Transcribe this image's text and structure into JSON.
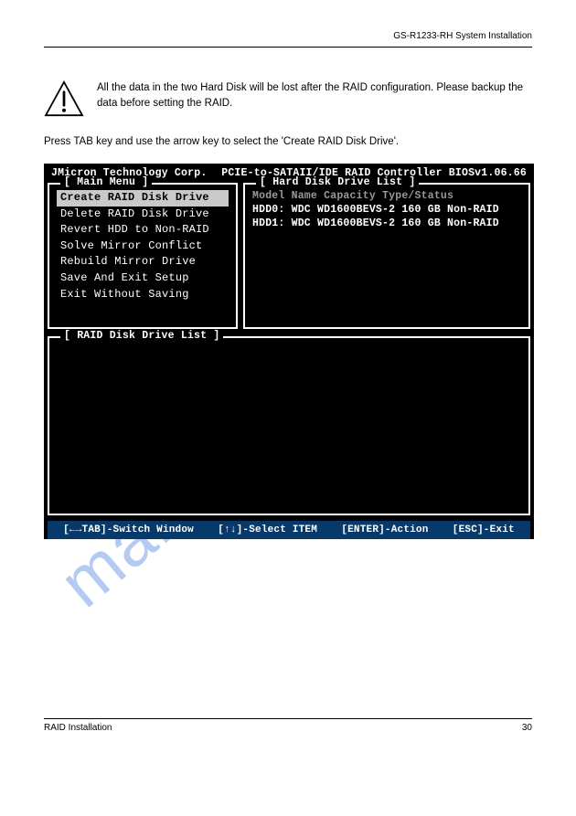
{
  "header": {
    "right": "GS-R1233-RH System Installation"
  },
  "warning": {
    "text": "All the data in the two Hard Disk will be lost after the RAID configuration. Please backup the data before setting the RAID."
  },
  "intro": "Press TAB key and use the arrow key to select the 'Create RAID Disk Drive'.",
  "bios": {
    "title_left": "JMicron Technology Corp.",
    "title_right": "PCIE-to-SATAII/IDE RAID Controller BIOSv1.06.66",
    "main_menu": {
      "legend": "[ Main Menu ]",
      "items": [
        {
          "label": "Create RAID Disk Drive",
          "selected": true
        },
        {
          "label": "Delete RAID Disk Drive",
          "selected": false
        },
        {
          "label": "Revert HDD to Non-RAID",
          "selected": false
        },
        {
          "label": "Solve Mirror Conflict",
          "selected": false
        },
        {
          "label": "Rebuild Mirror Drive",
          "selected": false
        },
        {
          "label": "Save And Exit Setup",
          "selected": false
        },
        {
          "label": "Exit Without Saving",
          "selected": false
        }
      ]
    },
    "hdd": {
      "legend": "[ Hard Disk Drive List ]",
      "head": "        Model Name      Capacity Type/Status",
      "rows": [
        "HDD0: WDC WD1600BEVS-2   160 GB Non-RAID",
        "HDD1: WDC WD1600BEVS-2   160 GB Non-RAID"
      ]
    },
    "raid_list": {
      "legend": "[ RAID Disk Drive List ]"
    },
    "status": {
      "s1": "[←→TAB]-Switch Window",
      "s2": "[↑↓]-Select ITEM",
      "s3": "[ENTER]-Action",
      "s4": "[ESC]-Exit"
    }
  },
  "watermark": "manualshive.com",
  "footer": {
    "left": "RAID Installation",
    "right": "30"
  }
}
